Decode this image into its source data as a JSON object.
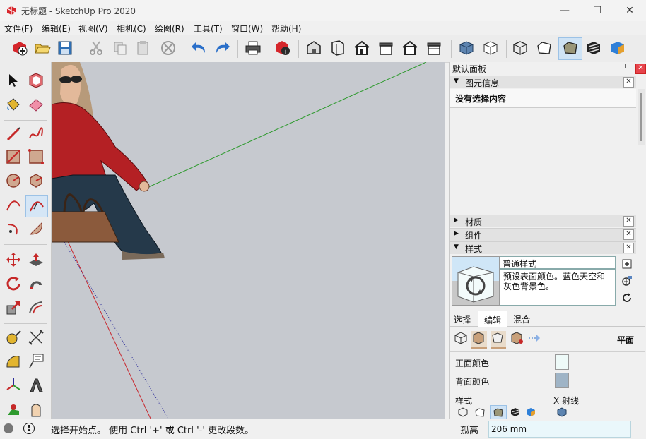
{
  "window": {
    "title": "无标题 - SketchUp Pro 2020",
    "minimize_glyph": "—",
    "maximize_glyph": "☐",
    "close_glyph": "✕"
  },
  "menu": {
    "items": [
      {
        "label": "文件(F)"
      },
      {
        "label": "编辑(E)"
      },
      {
        "label": "视图(V)"
      },
      {
        "label": "相机(C)"
      },
      {
        "label": "绘图(R)"
      },
      {
        "label": "工具(T)"
      },
      {
        "label": "窗口(W)"
      },
      {
        "label": "帮助(H)"
      }
    ]
  },
  "toolbar": {
    "icons": [
      "new-file-icon",
      "open-folder-icon",
      "save-icon",
      "cut-icon",
      "copy-icon",
      "paste-icon",
      "erase-icon",
      "undo-icon",
      "redo-icon",
      "print-icon",
      "model-info-icon",
      "iso-view-icon",
      "top-view-icon",
      "front-view-icon",
      "right-view-icon",
      "back-view-icon",
      "left-view-icon",
      "xray-icon",
      "wireframe-icon",
      "hidden-line-icon",
      "shaded-icon",
      "shaded-textures-icon",
      "monochrome-icon"
    ]
  },
  "left_tools": {
    "icons": [
      "select-icon",
      "make-component-icon",
      "paint-bucket-icon",
      "eraser-icon",
      "line-icon",
      "freehand-icon",
      "rectangle-icon",
      "rotated-rectangle-icon",
      "circle-icon",
      "polygon-icon",
      "arc-icon",
      "two-point-arc-icon",
      "three-point-arc-icon",
      "pie-icon",
      "move-icon",
      "push-pull-icon",
      "rotate-icon",
      "follow-me-icon",
      "scale-icon",
      "offset-icon",
      "tape-measure-icon",
      "dimension-icon",
      "protractor-icon",
      "text-icon",
      "axes-icon",
      "3d-text-icon",
      "walk-icon",
      "look-around-icon"
    ]
  },
  "panel": {
    "title": "默认面板",
    "pin_glyph": "📌",
    "close_glyph": "✕",
    "entity_info": {
      "header": "图元信息",
      "content": "没有选择内容"
    },
    "materials": {
      "header": "材质"
    },
    "components": {
      "header": "组件"
    },
    "styles": {
      "header": "样式",
      "style_name": "普通样式",
      "style_desc": "预设表面颜色。蓝色天空和灰色背景色。",
      "tabs": [
        "选择",
        "编辑",
        "混合"
      ],
      "active_tab": "编辑",
      "edit_mode_label": "平面",
      "front_color_label": "正面颜色",
      "back_color_label": "背面颜色",
      "front_color": "#eefaf8",
      "back_color": "#9fb4c6",
      "style_label": "样式",
      "xray_label": "X 射线"
    }
  },
  "viewport": {
    "bg_color": "#c6c9cf",
    "axis_green": "#2e9a2e",
    "axis_red": "#c8282f",
    "axis_blue": "#2b2b9a"
  },
  "status": {
    "message": "选择开始点。 使用 Ctrl '+' 或 Ctrl '-' 更改段数。",
    "measure_label": "孤高",
    "measure_value": "206 mm"
  }
}
